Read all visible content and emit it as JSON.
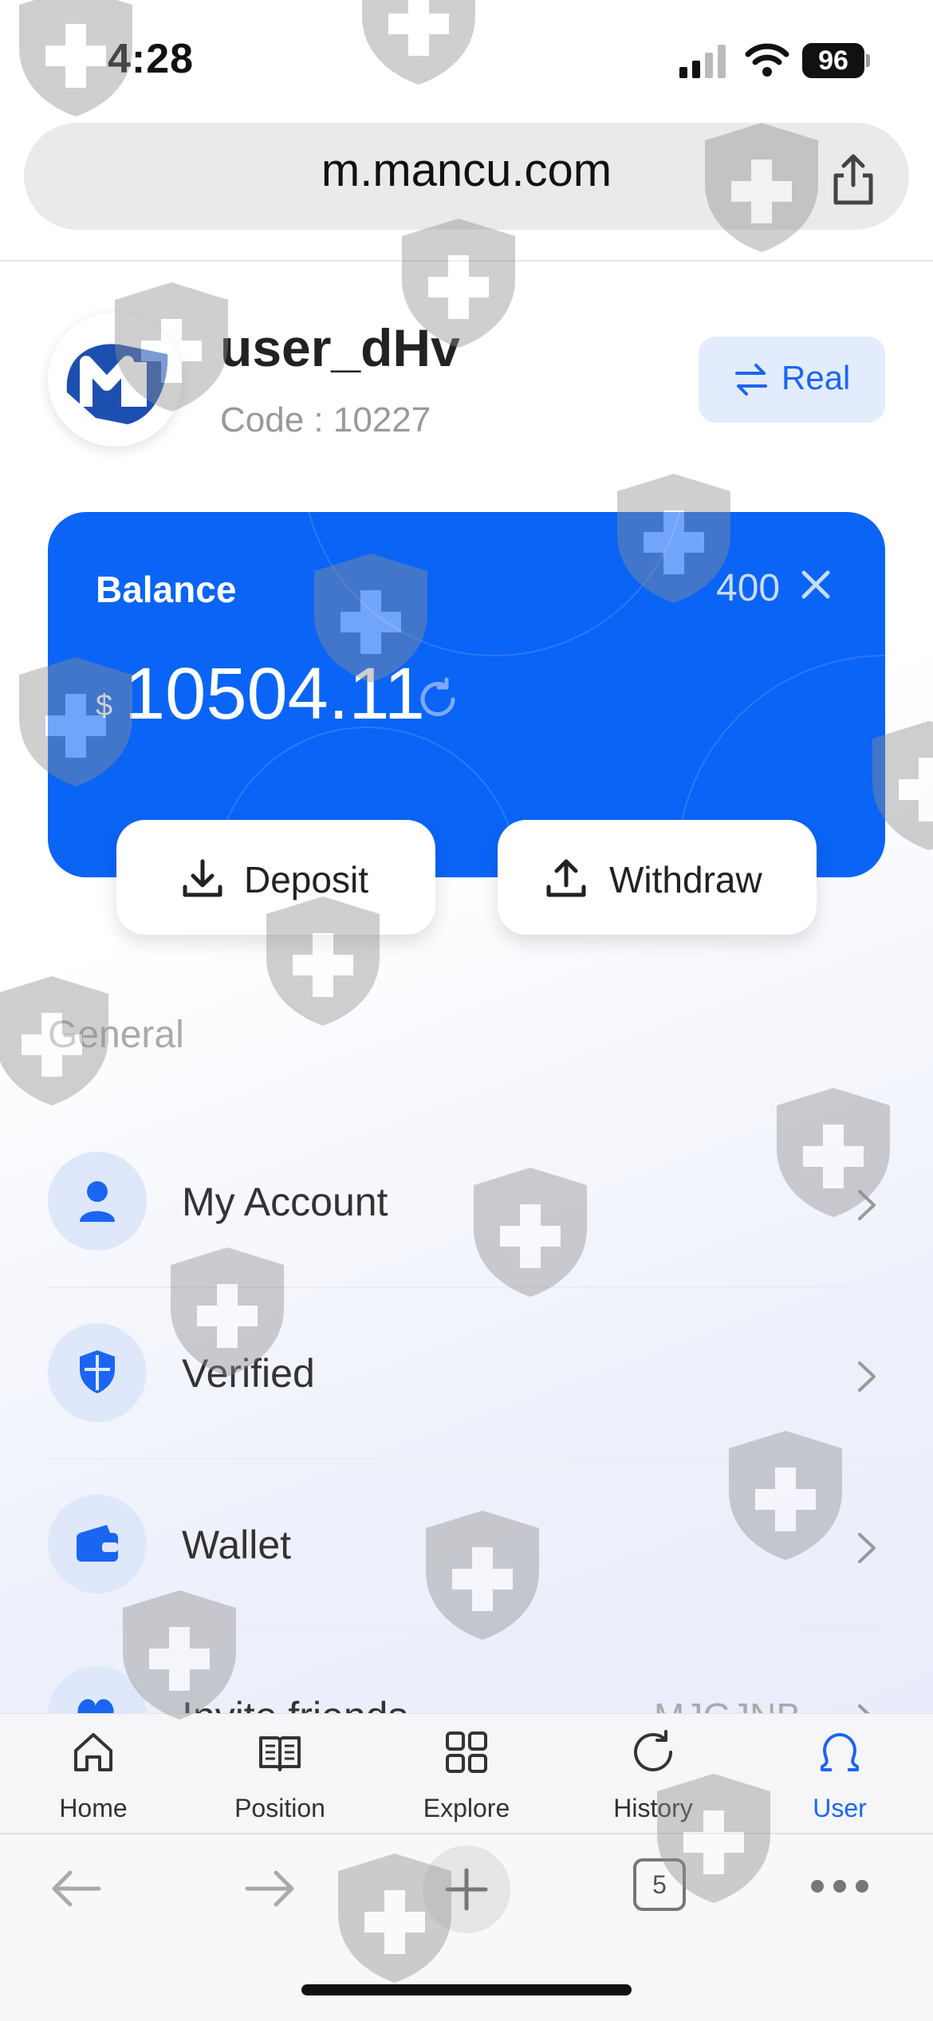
{
  "status_bar": {
    "time": "4:28",
    "battery": "96"
  },
  "browser": {
    "url": "m.mancu.com",
    "tab_count": "5"
  },
  "profile": {
    "username": "user_dHv",
    "code": "Code : 10227",
    "mode_label": "Real"
  },
  "balance": {
    "label": "Balance",
    "multiplier": "400",
    "currency": "$",
    "amount": "10504.11",
    "deposit_label": "Deposit",
    "withdraw_label": "Withdraw"
  },
  "general": {
    "title": "General",
    "items": [
      {
        "label": "My Account",
        "icon": "person-icon"
      },
      {
        "label": "Verified",
        "icon": "shield-icon"
      },
      {
        "label": "Wallet",
        "icon": "wallet-icon"
      },
      {
        "label": "Invite friends",
        "icon": "heart-plus-icon",
        "value": "MJGJNB"
      }
    ]
  },
  "tabs": [
    {
      "label": "Home",
      "icon": "home-icon",
      "active": false
    },
    {
      "label": "Position",
      "icon": "book-icon",
      "active": false
    },
    {
      "label": "Explore",
      "icon": "grid-icon",
      "active": false
    },
    {
      "label": "History",
      "icon": "refresh-icon",
      "active": false
    },
    {
      "label": "User",
      "icon": "user-icon",
      "active": true
    }
  ],
  "colors": {
    "accent": "#0a64f6",
    "accent_light": "#e3ecfd",
    "inactive_tab": "#333333"
  }
}
